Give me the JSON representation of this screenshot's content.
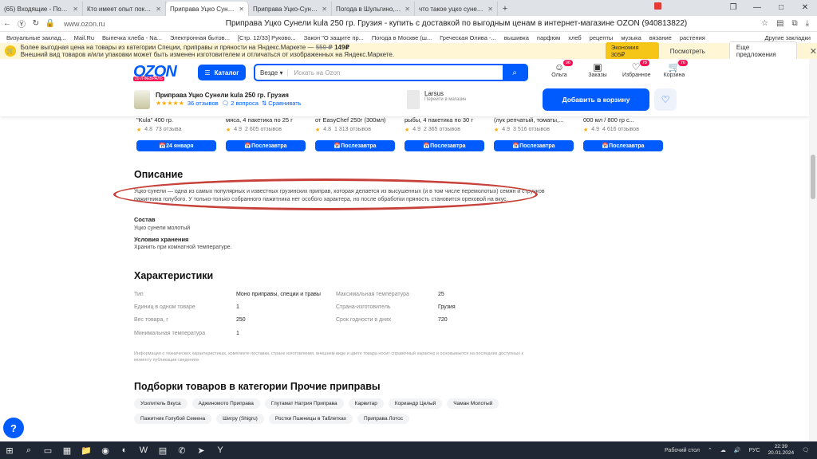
{
  "browser": {
    "tabs": [
      {
        "title": "(65) Входящие - Почта Mail",
        "color": "#f57c1f",
        "active": false
      },
      {
        "title": "Кто имеет опыт покупки т",
        "color": "#f2b90c",
        "active": false
      },
      {
        "title": "Приправа Уцко Сунели k",
        "color": "#005bff",
        "active": true
      },
      {
        "title": "Приправа Уцко-Сунели \"Ж",
        "color": "#222222",
        "active": false
      },
      {
        "title": "Погода в Шульгино, Рязан",
        "color": "#e53935",
        "active": false
      },
      {
        "title": "что такое уцко сунели —",
        "color": "#e53935",
        "active": false
      }
    ],
    "url": "www.ozon.ru",
    "page_title": "Приправа Уцко Сунели kula 250 гр. Грузия - купить с доставкой по выгодным ценам в интернет-магазине OZON (940813822)",
    "bookmarks": [
      "Визуальные заклад...",
      "Mail.Ru",
      "Выпечка хлеба - Na...",
      "Электронная бытов...",
      "[Стр. 12/33] Руково...",
      "Закон \"О защите пр...",
      "Погода в Москве (ш...",
      "Греческая Олива -...",
      "вышивка",
      "парфюм",
      "хлеб",
      "рецепты",
      "музыка",
      "вязание",
      "растения"
    ],
    "bookmarks_right": "Другие закладки"
  },
  "promo": {
    "line1": "Более выгодная цена на товары из категории Специи, приправы и пряности на Яндекс.Маркете —",
    "price_old": "550 ₽",
    "price_new": "149₽",
    "line2": "Внешний вид товаров и/или упаковки может быть изменен изготовителем и отличаться от изображенных на Яндекс.Маркете.",
    "economy": "Экономия 305₽",
    "look": "Посмотреть",
    "more": "Еще предложения"
  },
  "header": {
    "logo": "OZON",
    "logo_sub": "20 л ФЕВРАЛЬ",
    "catalog": "Каталог",
    "search_scope": "Везде",
    "search_placeholder": "Искать на Ozon",
    "icons": [
      {
        "label": "Ольга",
        "badge": "96"
      },
      {
        "label": "Заказы",
        "badge": ""
      },
      {
        "label": "Избранное",
        "badge": "78"
      },
      {
        "label": "Корзина",
        "badge": "76"
      }
    ]
  },
  "sticky": {
    "product": "Приправа Уцко Сунели kula 250 гр. Грузия",
    "stars": "★★★★★",
    "reviews": "36 отзывов",
    "questions": "2 вопроса",
    "compare": "Сравнивать",
    "seller_name": "Larsus",
    "seller_sub": "Перейти в магазин",
    "add_to_cart": "Добавить в корзину"
  },
  "recs": [
    {
      "name": "\"Kula\" 400 гр.",
      "rating": "4.8",
      "reviews": "73 отзыва",
      "button": "24 января"
    },
    {
      "name": "мяса, 4 пакетика по 25 г",
      "rating": "4.9",
      "reviews": "2 605 отзывов",
      "button": "Послезавтра"
    },
    {
      "name": "от EasyChef 250г (300мл)",
      "rating": "4.8",
      "reviews": "1 313 отзывов",
      "button": "Послезавтра"
    },
    {
      "name": "рыбы, 4 пакетика по 30 г",
      "rating": "4.9",
      "reviews": "2 365 отзывов",
      "button": "Послезавтра"
    },
    {
      "name": "(лук репчатый, томаты,...",
      "rating": "4.9",
      "reviews": "3 516 отзывов",
      "button": "Послезавтра"
    },
    {
      "name": "000 мл / 800 гр с...",
      "rating": "4.9",
      "reviews": "4 616 отзывов",
      "button": "Послезавтра"
    }
  ],
  "description": {
    "heading": "Описание",
    "text": "Уцко-сунели — одна из самых популярных и известных грузинских приправ, которая делается из высушенных (и в том числе перемолотых) семян и стручков пажитника голубого. У только-только собранного пажитника нет особого характера, но после обработки пряность становится ореховой на вкус.",
    "composition_label": "Состав",
    "composition": "Уцко сунели молотый",
    "storage_label": "Условия хранения",
    "storage": "Хранить при комнатной температуре."
  },
  "characteristics": {
    "heading": "Характеристики",
    "left": [
      {
        "k": "Тип",
        "v": "Моно приправы, специи и травы"
      },
      {
        "k": "Единиц в одном товаре",
        "v": "1"
      },
      {
        "k": "Вес товара, г",
        "v": "250"
      },
      {
        "k": "Минимальная температура",
        "v": "1"
      }
    ],
    "right": [
      {
        "k": "Максимальная температура",
        "v": "25"
      },
      {
        "k": "Страна-изготовитель",
        "v": "Грузия"
      },
      {
        "k": "Срок годности в днях",
        "v": "720"
      }
    ],
    "note": "Информация о технических характеристиках, комплекте поставки, стране изготовления, внешнем виде и цвете товара носит справочный характер и основывается на последних доступных к моменту публикации сведениях"
  },
  "collections": {
    "heading": "Подборки товаров в категории Прочие приправы",
    "chips": [
      "Усилитель Вкуса",
      "Аджиномото Приправа",
      "Глутамат Натрия Приправа",
      "Карвитар",
      "Кориандр Целый",
      "Чаман Молотый",
      "Пажитник Голубой Семена",
      "Шигру (Shigru)",
      "Ростки Пшеницы в Таблетках",
      "Приправа Лотос"
    ]
  },
  "taskbar": {
    "desktop": "Рабочий стол",
    "lang": "РУС",
    "time": "22:39",
    "date": "20.01.2024"
  }
}
